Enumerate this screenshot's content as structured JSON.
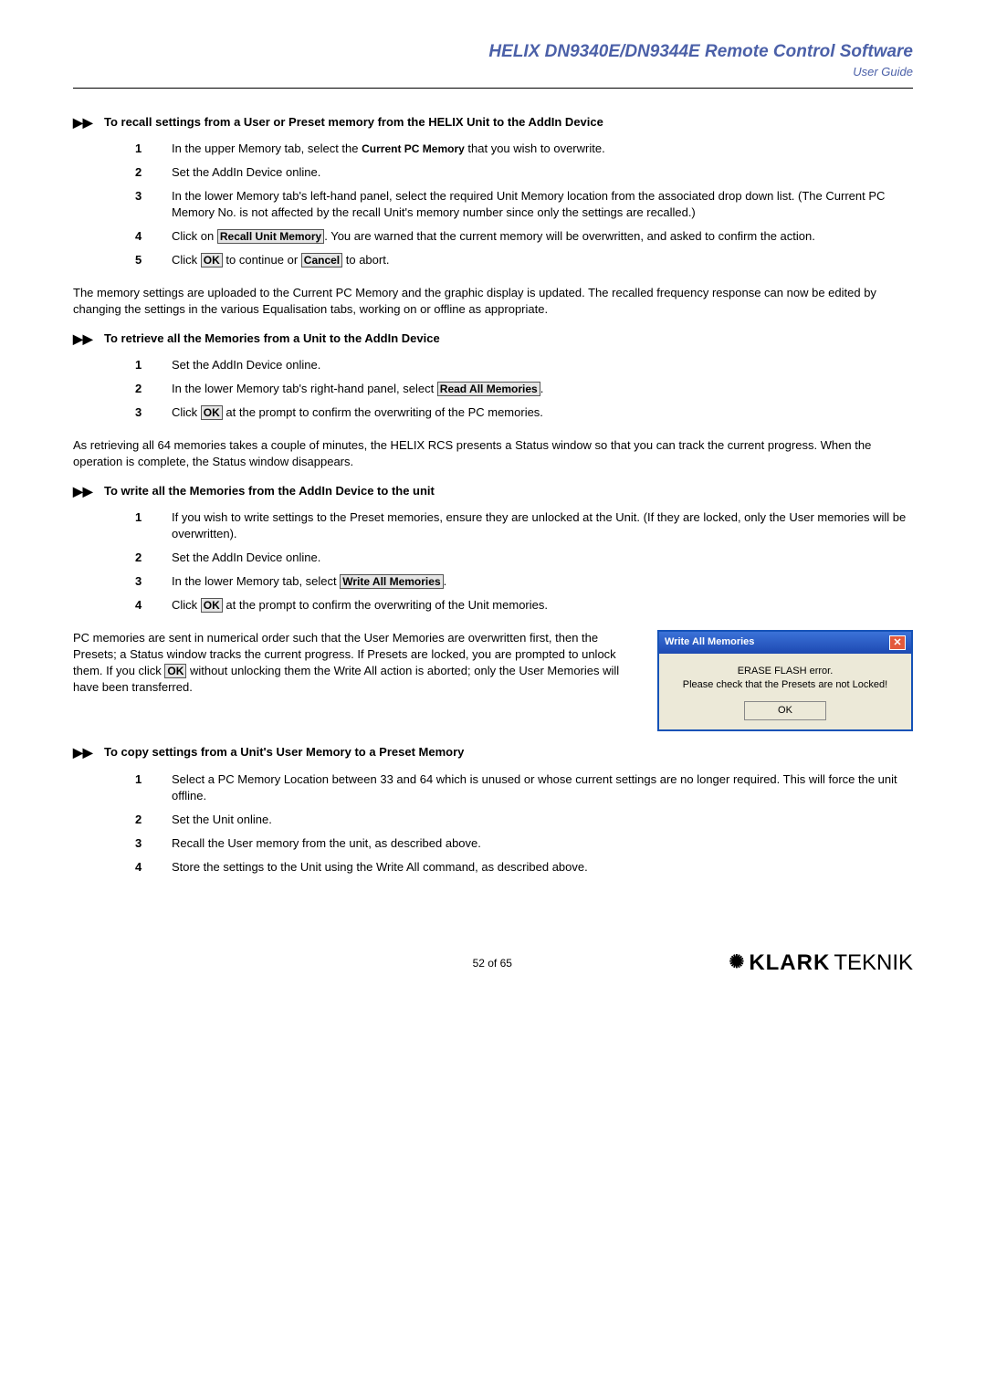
{
  "header": {
    "title": "HELIX DN9340E/DN9344E Remote Control Software",
    "subtitle": "User Guide"
  },
  "s1": {
    "title": "To recall settings from a User or Preset memory from the HELIX Unit to the AddIn Device",
    "step1a": "In the upper Memory tab, select the ",
    "step1b": " that you wish to overwrite.",
    "step2": "Set the AddIn Device online.",
    "step3": "In the lower Memory tab's left-hand panel, select the required Unit Memory location from the associated drop down list.  (The Current PC Memory No. is not affected by the recall Unit's memory number since only the settings are recalled.)",
    "step4a": "Click on ",
    "step4b": ".  You are warned that the current memory will be overwritten, and asked to confirm the action.",
    "step5a": "Click ",
    "step5b": " to continue or ",
    "step5c": " to abort.",
    "body": "The memory settings are uploaded to the Current PC Memory and the graphic display is updated.  The recalled frequency response can now be edited by changing the settings in the various Equalisation tabs, working on or offline as appropriate."
  },
  "s2": {
    "title": "To retrieve all the Memories from a Unit to the AddIn Device",
    "step1": "Set the AddIn Device online.",
    "step2a": "In the lower Memory tab's right-hand panel, select ",
    "step2b": ".",
    "step3a": "Click ",
    "step3b": " at the prompt to confirm the overwriting of the PC memories.",
    "body": "As retrieving all 64 memories takes a couple of minutes, the HELIX RCS presents a Status window so that you can track the current progress.  When the operation is complete, the Status window disappears."
  },
  "s3": {
    "title": "To write all the Memories from the AddIn Device to the unit",
    "step1": "If you wish to write settings to the Preset memories, ensure they are unlocked at the Unit.  (If they are locked, only the User memories will be overwritten).",
    "step2": "Set the AddIn Device online.",
    "step3a": "In the lower Memory tab, select ",
    "step3b": ".",
    "step4a": "Click ",
    "step4b": " at the prompt to confirm the overwriting of the Unit memories.",
    "body_a": "PC memories are sent in numerical order such that the User Memories are overwritten first, then the Presets; a Status window tracks the current progress.  If Presets are locked, you are prompted to unlock them.  If you click ",
    "body_b": " without unlocking them the Write All action is aborted; only the User Memories will have been transferred."
  },
  "s4": {
    "title": "To copy settings from a Unit's User Memory to a Preset Memory",
    "step1": "Select a PC Memory Location between 33 and 64 which is unused or whose current settings are no longer required.  This will force the unit offline.",
    "step2": "Set the Unit online.",
    "step3": "Recall the User memory from the unit, as described above.",
    "step4": "Store the settings to the Unit using the Write All command, as described above."
  },
  "ui": {
    "currentPC": "Current PC Memory",
    "recallUnit": "Recall Unit Memory",
    "ok": "OK",
    "cancel": "Cancel",
    "readAll": "Read All Memories",
    "writeAll": "Write All Memories"
  },
  "dialog": {
    "title": "Write All Memories",
    "line1": "ERASE FLASH error.",
    "line2": "Please check that the Presets are not Locked!",
    "ok": "OK"
  },
  "footer": {
    "page": "52 of 65",
    "brand1": "KLARK",
    "brand2": "TEKNIK"
  }
}
